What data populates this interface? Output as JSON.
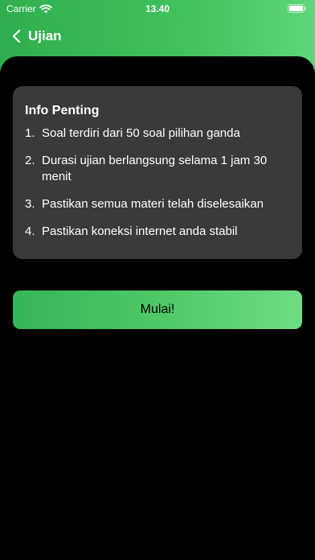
{
  "status_bar": {
    "carrier": "Carrier",
    "time": "13.40"
  },
  "nav": {
    "title": "Ujian",
    "back_icon": "chevron-left-icon"
  },
  "info_card": {
    "title": "Info Penting",
    "items": [
      {
        "num": "1.",
        "text": "Soal terdiri dari 50 soal pilihan ganda"
      },
      {
        "num": "2.",
        "text": "Durasi ujian berlangsung selama 1 jam 30 menit"
      },
      {
        "num": "3.",
        "text": "Pastikan semua materi telah diselesaikan"
      },
      {
        "num": "4.",
        "text": "Pastikan koneksi internet anda stabil"
      }
    ]
  },
  "start_button": {
    "label": "Mulai!"
  },
  "colors": {
    "header_gradient_start": "#2fae4f",
    "header_gradient_end": "#5fd67a",
    "card_background": "#3a3a3c",
    "button_gradient_start": "#34b557",
    "button_gradient_end": "#6edc82",
    "background": "#000000"
  }
}
